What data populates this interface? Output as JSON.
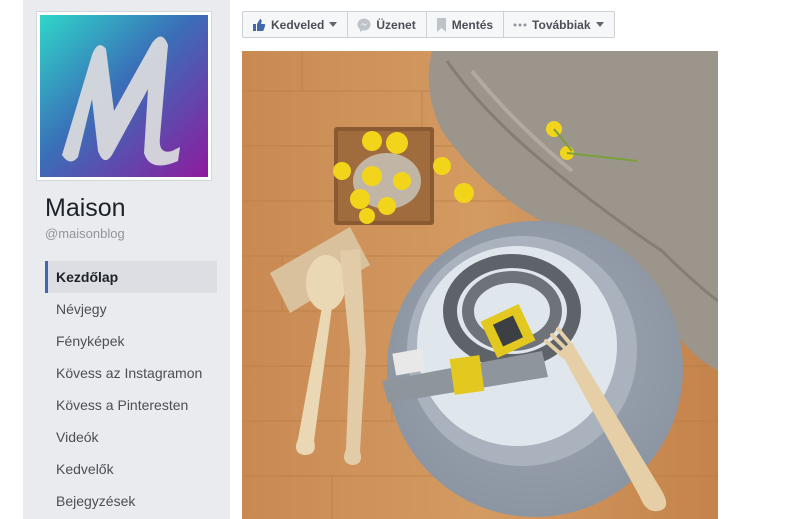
{
  "page": {
    "name": "Maison",
    "handle": "@maisonblog"
  },
  "nav": {
    "items": [
      {
        "label": "Kezdőlap",
        "active": true
      },
      {
        "label": "Névjegy"
      },
      {
        "label": "Fényképek"
      },
      {
        "label": "Kövess az Instagramon"
      },
      {
        "label": "Kövess a Pinteresten"
      },
      {
        "label": "Videók"
      },
      {
        "label": "Kedvelők"
      },
      {
        "label": "Bejegyzések"
      }
    ]
  },
  "actions": {
    "like_label": "Kedveled",
    "message_label": "Üzenet",
    "save_label": "Mentés",
    "more_label": "Továbbiak"
  },
  "colors": {
    "sidebar_bg": "#e9ebee",
    "accent": "#4267b2",
    "logo_gradient_start": "#2fd1c8",
    "logo_gradient_end": "#8a1fa0"
  },
  "icons": {
    "like": "thumbs-up-icon",
    "message": "messenger-icon",
    "save": "bookmark-icon",
    "more": "more-dots-icon"
  }
}
